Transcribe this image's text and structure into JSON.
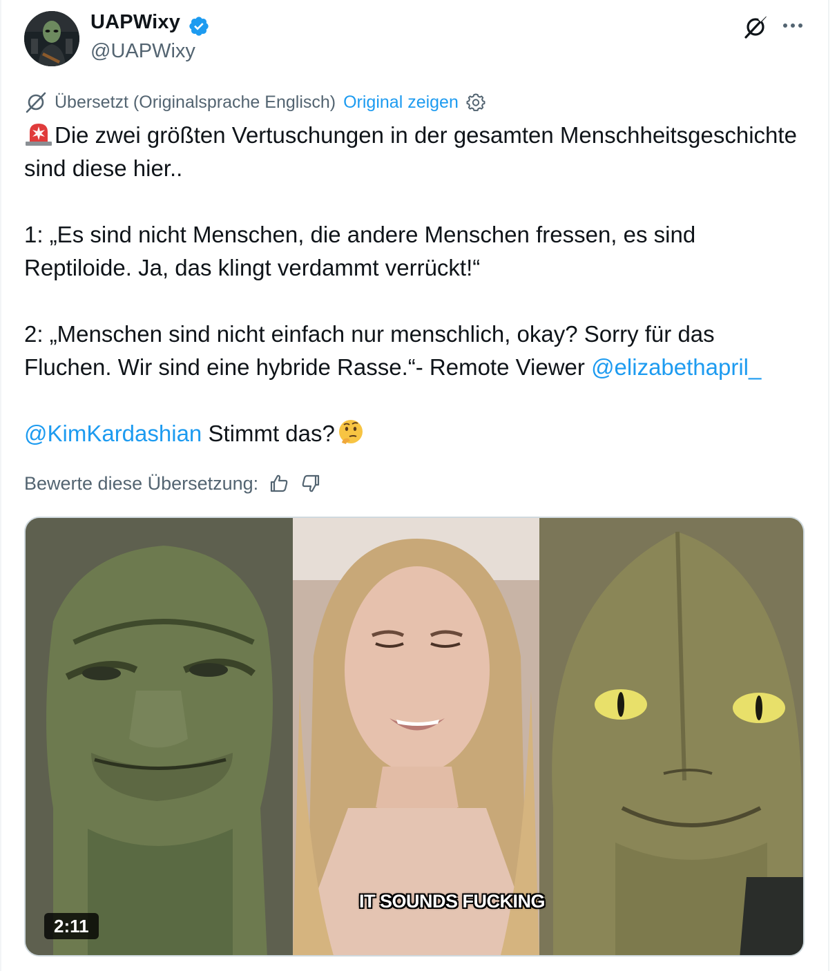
{
  "author": {
    "display_name": "UAPWixy",
    "handle": "@UAPWixy",
    "verified": true
  },
  "header_icons": [
    "grok-icon",
    "more-icon"
  ],
  "translation": {
    "notice": "Übersetzt (Originalsprache Englisch)",
    "show_original": "Original zeigen"
  },
  "tweet": {
    "line1_emoji": "🚨",
    "paragraph1": "Die zwei größten Vertuschungen in der gesamten Menschheitsgeschichte sind diese hier..",
    "paragraph2": "1: „Es sind nicht Menschen, die andere Menschen fressen, es sind Reptiloide. Ja, das klingt verdammt verrückt!“",
    "paragraph3_text": "2: „Menschen sind nicht einfach nur menschlich, okay? Sorry für das Fluchen. Wir sind eine hybride Rasse.“- Remote Viewer ",
    "paragraph3_mention": "@elizabethapril_",
    "paragraph4_mention": "@KimKardashian",
    "paragraph4_text": " Stimmt das?",
    "paragraph4_emoji": "🤔"
  },
  "rating": {
    "label": "Bewerte diese Übersetzung:"
  },
  "media": {
    "caption": "IT SOUNDS FUCKING",
    "duration": "2:11"
  },
  "colors": {
    "accent": "#1d9bf0",
    "text": "#0f1419",
    "muted": "#536471",
    "border": "#cfd9de"
  }
}
